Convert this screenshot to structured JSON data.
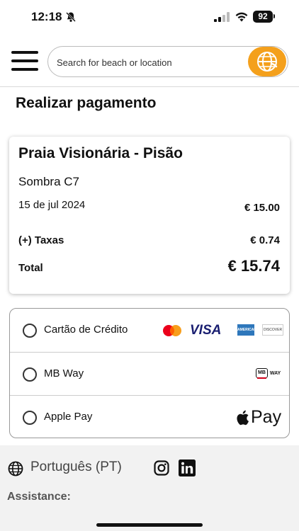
{
  "status_bar": {
    "time": "12:18",
    "battery": "92",
    "icons": [
      "bell-slash-icon",
      "cellular-signal-icon",
      "wifi-icon",
      "battery-icon"
    ]
  },
  "header": {
    "menu_icon": "hamburger-menu-icon",
    "search": {
      "placeholder": "Search for beach or location",
      "value": ""
    },
    "logo_icon": "globe-logo-icon",
    "accent_color": "#f4a01c"
  },
  "page": {
    "title": "Realizar pagamento"
  },
  "summary": {
    "beach_name": "Praia Visionária - Pisão",
    "spot": "Sombra C7",
    "date": "15 de jul 2024",
    "price": "€ 15.00",
    "taxes_label": "(+) Taxas",
    "taxes_value": "€ 0.74",
    "total_label": "Total",
    "total_value": "€ 15.74"
  },
  "payment_methods": [
    {
      "label": "Cartão de Crédito",
      "selected": false,
      "icons": [
        "mastercard-icon",
        "visa-icon",
        "american-express-icon",
        "discover-icon"
      ],
      "visa_text": "VISA",
      "amex_text": "AMERICAN EXPRESS",
      "discover_text": "DISCOVER"
    },
    {
      "label": "MB Way",
      "selected": false,
      "icons": [
        "mbway-icon"
      ],
      "mb_text": "MB",
      "way_text": "WAY"
    },
    {
      "label": "Apple Pay",
      "selected": false,
      "icons": [
        "apple-pay-icon"
      ],
      "pay_text": "Pay"
    }
  ],
  "footer": {
    "language": "Português (PT)",
    "social_icons": [
      "instagram-icon",
      "linkedin-icon"
    ],
    "assistance_heading": "Assistance:"
  }
}
